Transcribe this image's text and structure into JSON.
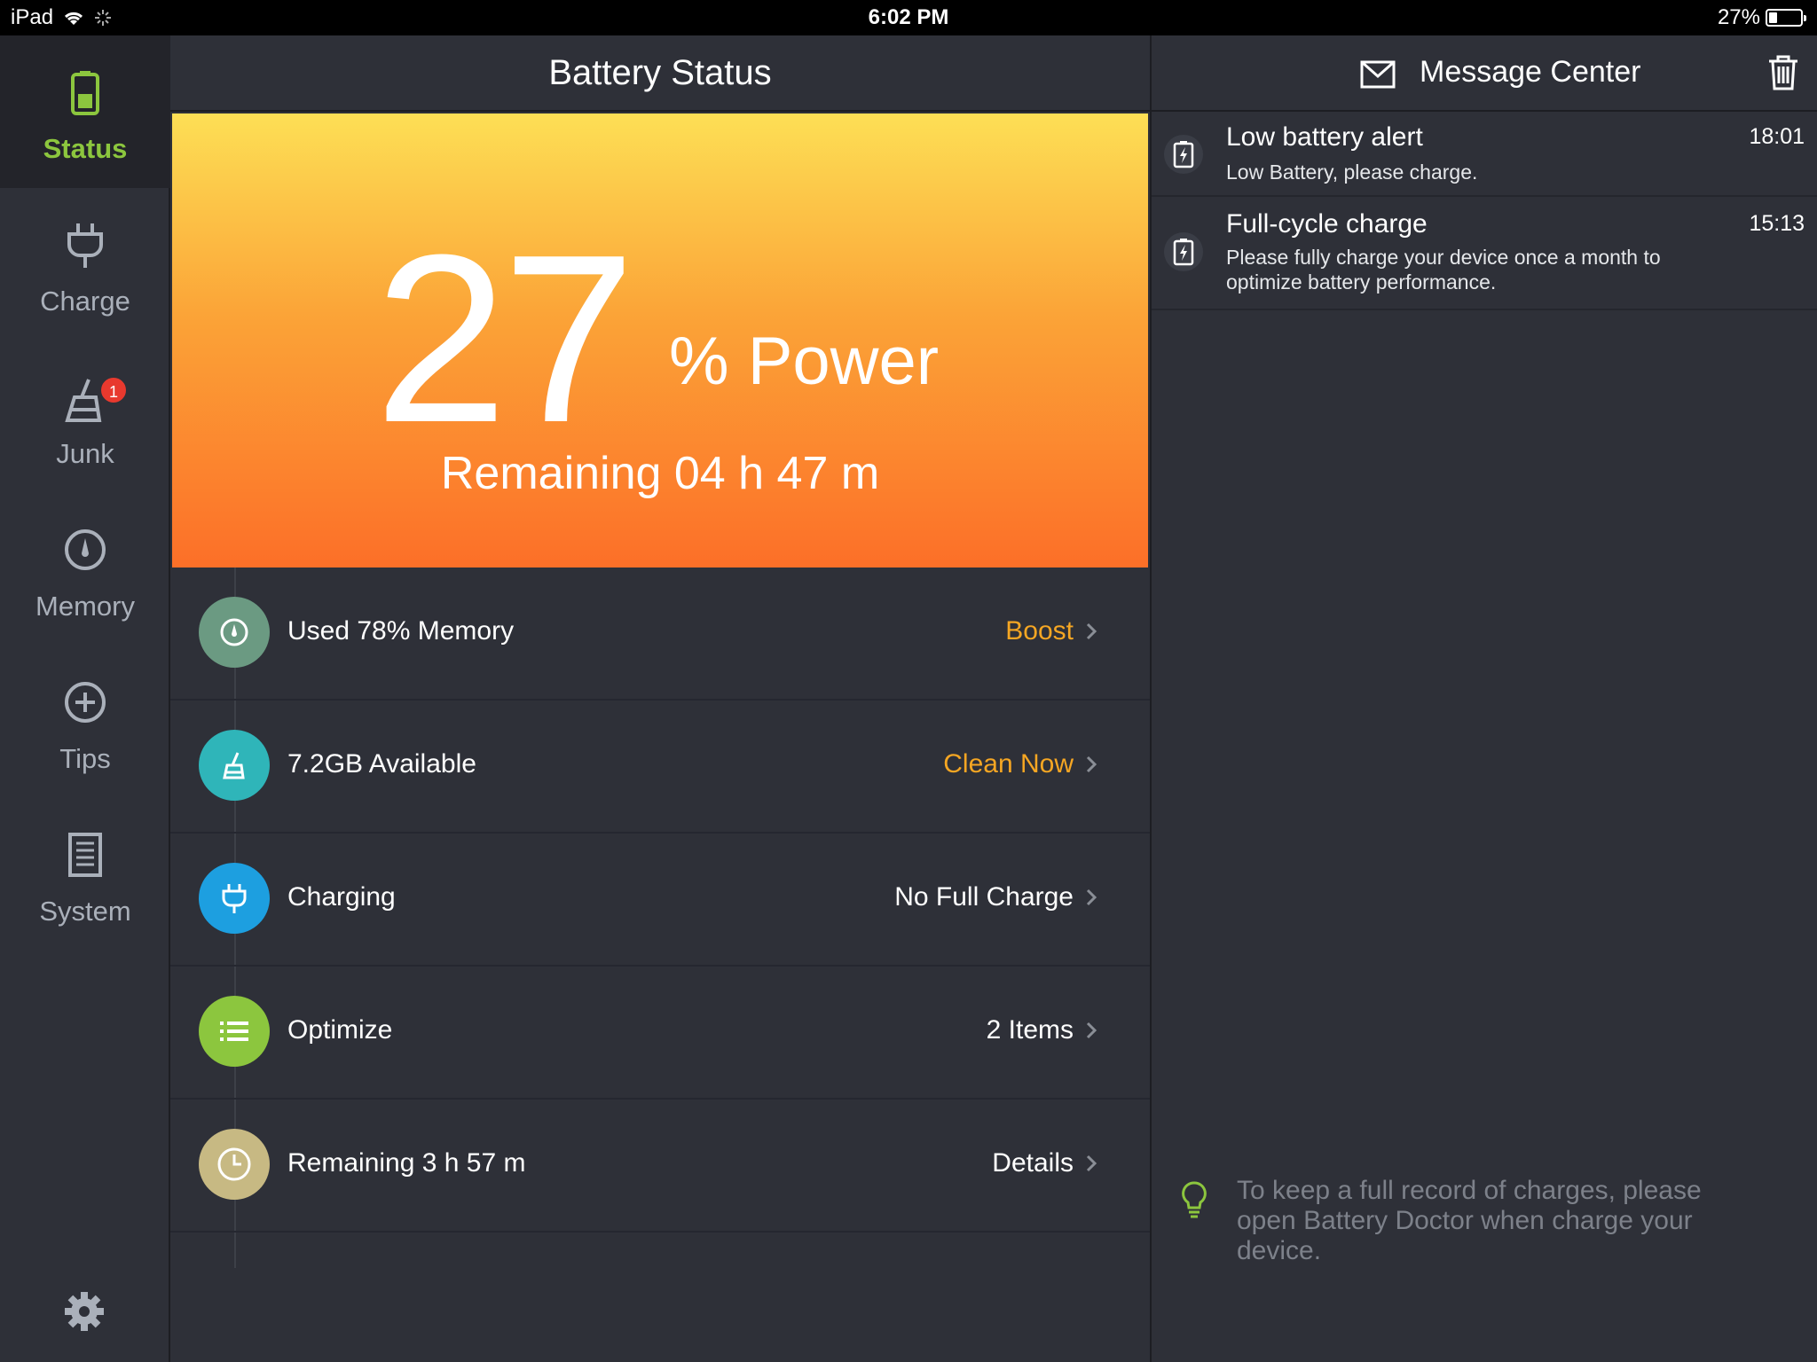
{
  "status_bar": {
    "device": "iPad",
    "time": "6:02 PM",
    "battery_percent": "27%",
    "battery_level": 0.27
  },
  "sidebar": {
    "items": [
      {
        "label": "Status",
        "icon": "battery-icon",
        "active": true
      },
      {
        "label": "Charge",
        "icon": "plug-icon",
        "active": false
      },
      {
        "label": "Junk",
        "icon": "broom-icon",
        "active": false,
        "badge": "1"
      },
      {
        "label": "Memory",
        "icon": "gauge-icon",
        "active": false
      },
      {
        "label": "Tips",
        "icon": "plus-circle-icon",
        "active": false
      },
      {
        "label": "System",
        "icon": "document-icon",
        "active": false
      }
    ],
    "settings_icon": "gear-icon"
  },
  "main": {
    "title": "Battery Status",
    "power_value": "27",
    "power_unit": "% Power",
    "remaining": "Remaining 04 h 47 m",
    "rows": [
      {
        "label": "Used 78% Memory",
        "action": "Boost",
        "icon_color": "#6b9a82",
        "action_color": "orange"
      },
      {
        "label": "7.2GB Available",
        "action": "Clean Now",
        "icon_color": "#2fb5b9",
        "action_color": "orange"
      },
      {
        "label": "Charging",
        "action": "No Full Charge",
        "icon_color": "#1d9fe0",
        "action_color": "white"
      },
      {
        "label": "Optimize",
        "action": "2 Items",
        "icon_color": "#8cc63e",
        "action_color": "white"
      },
      {
        "label": "Remaining 3 h 57 m",
        "action": "Details",
        "icon_color": "#c7b983",
        "action_color": "white"
      }
    ]
  },
  "panel": {
    "title": "Message Center",
    "messages": [
      {
        "title": "Low battery alert",
        "body": "Low Battery, please charge.",
        "time": "18:01"
      },
      {
        "title": "Full-cycle charge",
        "body": "Please fully charge your device once a month to optimize battery performance.",
        "time": "15:13"
      }
    ],
    "tip": "To keep a full record of charges,  please open Battery Doctor when charge your device."
  },
  "colors": {
    "accent_green": "#8cc63e",
    "action_orange": "#f5a623",
    "badge_red": "#e8392e",
    "hero_top": "#fddf55",
    "hero_bottom": "#fc6f28"
  }
}
